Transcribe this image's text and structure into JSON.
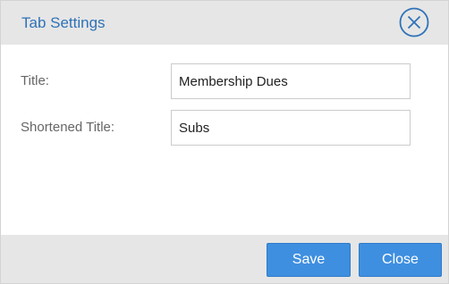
{
  "dialog": {
    "title": "Tab Settings",
    "close_icon": "close-circle-icon"
  },
  "form": {
    "title_label": "Title:",
    "title_value": "Membership Dues",
    "short_label": "Shortened Title:",
    "short_value": "Subs"
  },
  "footer": {
    "save_label": "Save",
    "close_label": "Close"
  },
  "colors": {
    "accent": "#2f72b8",
    "button": "#3f8fe0",
    "header_bg": "#e6e6e6"
  }
}
